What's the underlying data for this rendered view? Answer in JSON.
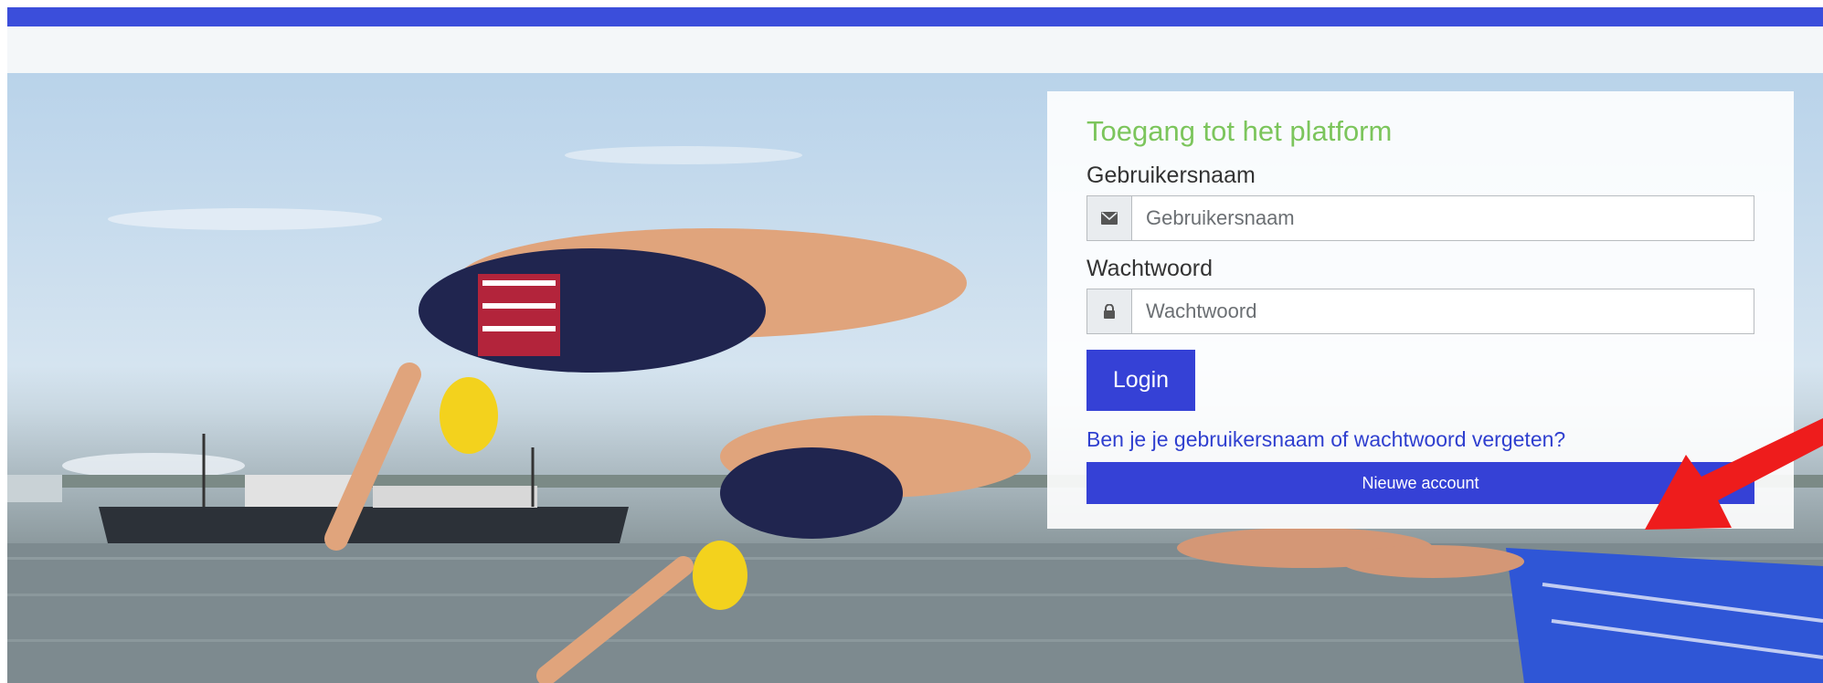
{
  "colors": {
    "topbar": "#3b4edb",
    "accent_green": "#7cc55c",
    "primary_button": "#3541d6",
    "link": "#2f3fcf",
    "arrow": "#ee1c1c"
  },
  "login": {
    "title": "Toegang tot het platform",
    "username_label": "Gebruikersnaam",
    "username_placeholder": "Gebruikersnaam",
    "username_icon": "envelope-icon",
    "password_label": "Wachtwoord",
    "password_placeholder": "Wachtwoord",
    "password_icon": "lock-icon",
    "login_button": "Login",
    "forgot_link": "Ben je je gebruikersnaam of wachtwoord vergeten?",
    "new_account_button": "Nieuwe account"
  },
  "background": {
    "icon": "swimmers-diving-photo"
  },
  "annotation": {
    "icon": "red-arrow-icon"
  }
}
